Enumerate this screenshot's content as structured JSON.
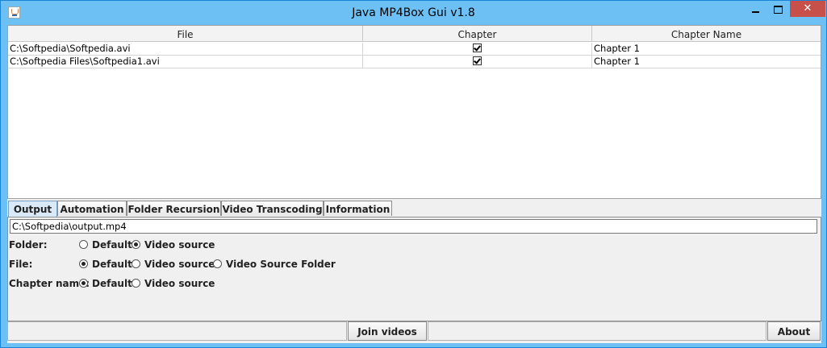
{
  "window": {
    "title": "Java MP4Box Gui v1.8",
    "icon": "java-cup-icon",
    "controls": {
      "minimize": "minimize-icon",
      "maximize": "maximize-icon",
      "close": "✕"
    }
  },
  "table": {
    "columns": [
      "File",
      "Chapter",
      "Chapter Name"
    ],
    "rows": [
      {
        "file": "C:\\Softpedia\\Softpedia.avi",
        "chapter": true,
        "chapter_name": "Chapter 1"
      },
      {
        "file": "C:\\Softpedia Files\\Softpedia1.avi",
        "chapter": true,
        "chapter_name": "Chapter 1"
      }
    ]
  },
  "tabs": [
    "Output",
    "Automation",
    "Folder Recursion",
    "Video Transcoding",
    "Information"
  ],
  "active_tab": "Output",
  "output": {
    "path": "C:\\Softpedia\\output.mp4",
    "folder": {
      "label": "Folder:",
      "options": [
        "Default",
        "Video source"
      ],
      "selected": "Video source"
    },
    "file": {
      "label": "File:",
      "options": [
        "Default",
        "Video source",
        "Video Source Folder"
      ],
      "selected": "Default"
    },
    "chapter_name": {
      "label": "Chapter name:",
      "options": [
        "Default",
        "Video source"
      ],
      "selected": "Default"
    }
  },
  "buttons": {
    "join": "Join videos",
    "about": "About"
  },
  "colors": {
    "titlebar": "#6cc0f3",
    "close": "#c7504b",
    "active_tab": "#dae9f7"
  }
}
